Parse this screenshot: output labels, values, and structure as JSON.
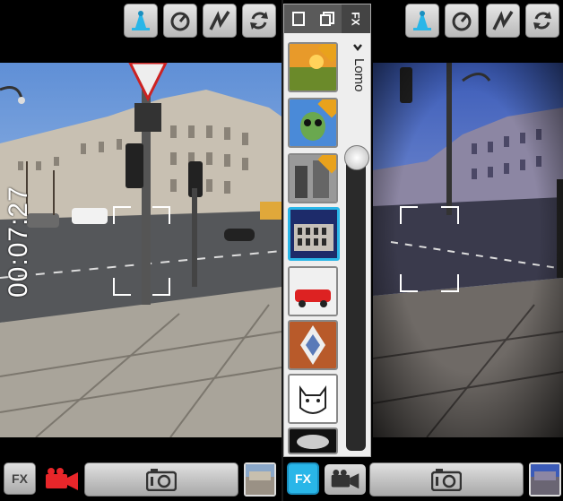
{
  "left_screen": {
    "recording_timer": "00:07:27",
    "top_buttons": [
      {
        "name": "tilt-shift-icon"
      },
      {
        "name": "timer-icon"
      },
      {
        "name": "flash-icon"
      },
      {
        "name": "switch-camera-icon"
      }
    ],
    "fx_button_label": "FX",
    "mode": "video"
  },
  "right_screen": {
    "fx_panel": {
      "tabs": [
        {
          "icon": "portrait-frame-icon"
        },
        {
          "icon": "multi-frame-icon"
        },
        {
          "label": "FX"
        }
      ],
      "current_effect": "Lomo",
      "filters": [
        {
          "name": "sunset-field",
          "locked": true,
          "selected": false
        },
        {
          "name": "alien",
          "locked": true,
          "selected": false
        },
        {
          "name": "bw-city",
          "locked": true,
          "selected": false
        },
        {
          "name": "colosseum",
          "locked": false,
          "selected": true
        },
        {
          "name": "red-car",
          "locked": false,
          "selected": false
        },
        {
          "name": "kaleidoscope",
          "locked": false,
          "selected": false
        },
        {
          "name": "cat-sketch",
          "locked": false,
          "selected": false
        },
        {
          "name": "light-partial",
          "locked": false,
          "selected": false
        }
      ],
      "intensity": 0.1
    },
    "fx_button_label": "FX",
    "mode": "photo"
  },
  "colors": {
    "accent": "#29b6e8",
    "record_red": "#e8262a",
    "button_light": "#d6d6d6"
  }
}
